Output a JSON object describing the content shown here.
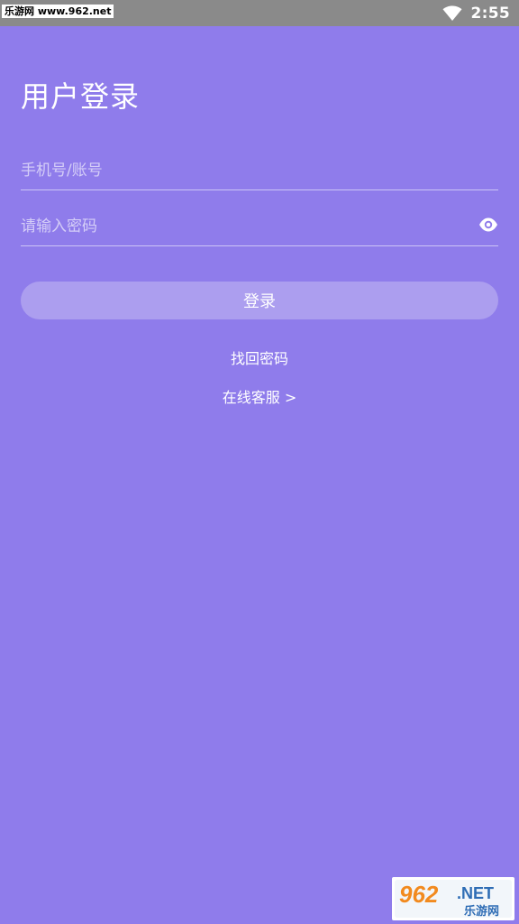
{
  "status_bar": {
    "watermark": "乐游网 www.962.net",
    "time": "2:55"
  },
  "login": {
    "title": "用户登录",
    "account_placeholder": "手机号/账号",
    "password_placeholder": "请输入密码",
    "login_button": "登录",
    "find_password": "找回密码",
    "online_service": "在线客服 >"
  },
  "icons": {
    "wifi": "wifi-icon",
    "password_toggle": "eye-icon",
    "corner_logo": "962-net-logo"
  },
  "colors": {
    "background": "#8F7CEB",
    "button": "#AC9EEF",
    "status_bar": "#8A8A8A"
  },
  "corner_logo": {
    "text": "962.NET 乐游网"
  }
}
